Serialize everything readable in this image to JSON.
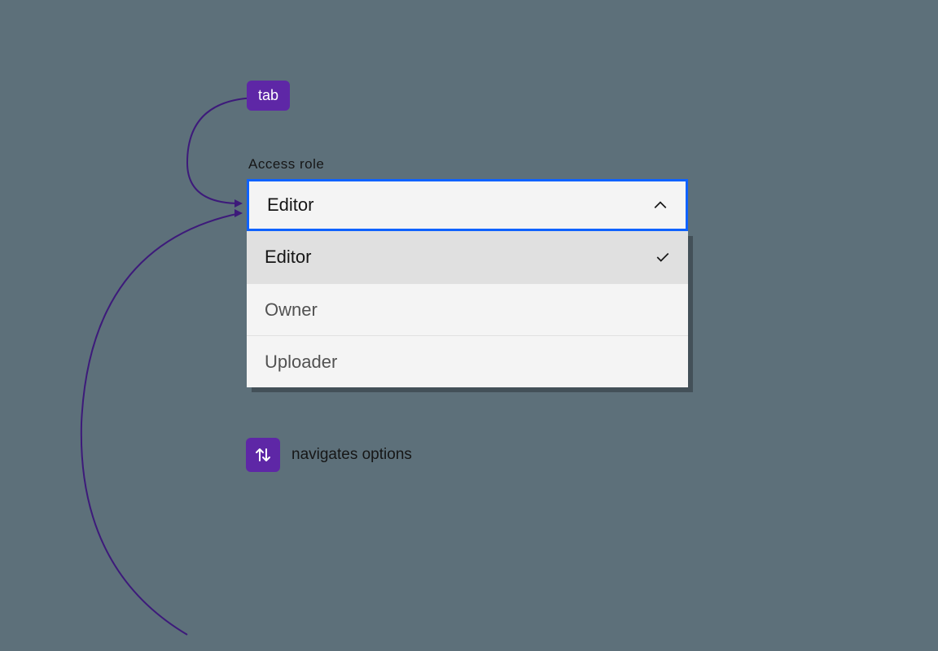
{
  "badge": {
    "label": "tab"
  },
  "field": {
    "label": "Access role"
  },
  "dropdown": {
    "selected": "Editor",
    "options": [
      {
        "label": "Editor",
        "selected": true
      },
      {
        "label": "Owner",
        "selected": false
      },
      {
        "label": "Uploader",
        "selected": false
      }
    ]
  },
  "hint": {
    "text": "navigates options"
  }
}
